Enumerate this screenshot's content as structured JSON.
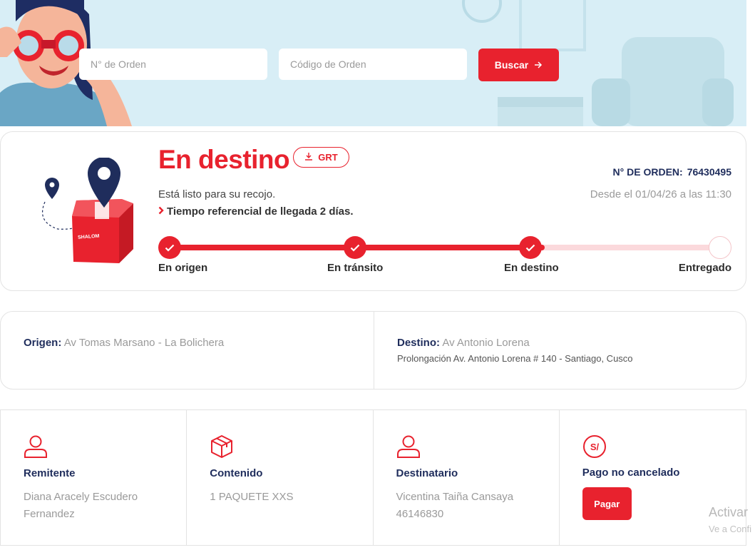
{
  "search": {
    "order_number_placeholder": "N° de Orden",
    "order_code_placeholder": "Código de Orden",
    "button_label": "Buscar"
  },
  "status": {
    "title": "En destino",
    "grt_label": "GRT",
    "message": "Está listo para su recojo.",
    "eta": "Tiempo referencial de llegada 2 días.",
    "order_label": "N° DE ORDEN:",
    "order_number": "76430495",
    "since": "Desde el 01/04/26 a las 11:30",
    "progress": 0.68,
    "steps": [
      {
        "label": "En origen",
        "done": true
      },
      {
        "label": "En tránsito",
        "done": true
      },
      {
        "label": "En destino",
        "done": true
      },
      {
        "label": "Entregado",
        "done": false
      }
    ]
  },
  "address": {
    "origin_label": "Origen:",
    "origin_value": "Av Tomas Marsano - La Bolichera",
    "destination_label": "Destino:",
    "destination_value": "Av Antonio Lorena",
    "destination_detail": "Prolongación Av. Antonio Lorena # 140 - Santiago, Cusco"
  },
  "info": {
    "sender_label": "Remitente",
    "sender_value": "Diana Aracely Escudero Fernandez",
    "content_label": "Contenido",
    "content_value": "1 PAQUETE XXS",
    "recipient_label": "Destinatario",
    "recipient_name": "Vicentina Taiña Cansaya",
    "recipient_id": "46146830",
    "payment_label": "Pago no cancelado",
    "pay_button": "Pagar"
  },
  "watermark": {
    "line1": "Activar",
    "line2": "Ve a Confi"
  },
  "colors": {
    "accent": "#e8222e",
    "navy": "#1f2d5c",
    "hero_bg": "#d8eef6"
  },
  "icons": [
    "arrow-right-icon",
    "download-icon",
    "chevron-right-icon",
    "check-icon",
    "user-icon",
    "box-icon",
    "soles-icon",
    "map-pin-icon"
  ]
}
